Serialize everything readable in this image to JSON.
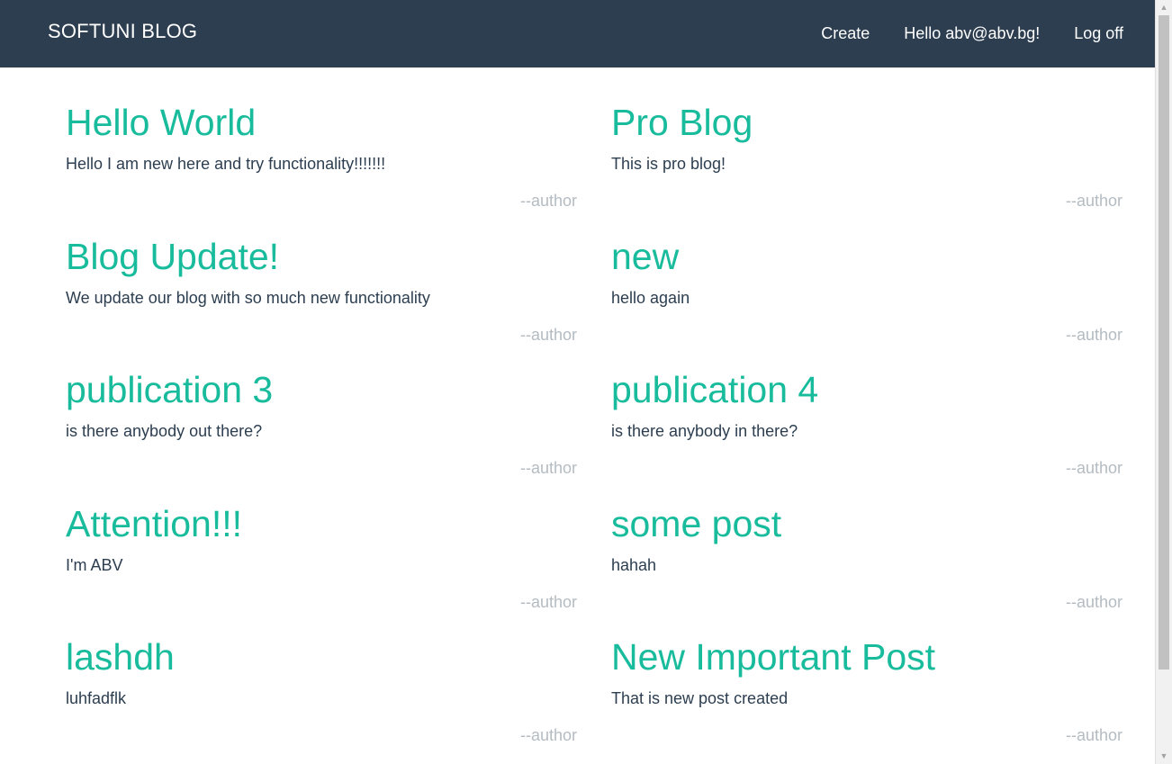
{
  "navbar": {
    "brand": "SOFTUNI BLOG",
    "links": [
      {
        "label": "Create"
      },
      {
        "label": "Hello abv@abv.bg!"
      },
      {
        "label": "Log off"
      }
    ]
  },
  "posts": [
    {
      "title": "Hello World",
      "content": "Hello I am new here and try functionality!!!!!!!",
      "author": "--author"
    },
    {
      "title": "Pro Blog",
      "content": "This is pro blog!",
      "author": "--author"
    },
    {
      "title": "Blog Update!",
      "content": "We update our blog with so much new functionality",
      "author": "--author"
    },
    {
      "title": "new",
      "content": "hello again",
      "author": "--author"
    },
    {
      "title": "publication 3",
      "content": "is there anybody out there?",
      "author": "--author"
    },
    {
      "title": "publication 4",
      "content": "is there anybody in there?",
      "author": "--author"
    },
    {
      "title": "Attention!!!",
      "content": "I'm ABV",
      "author": "--author"
    },
    {
      "title": "some post",
      "content": "hahah",
      "author": "--author"
    },
    {
      "title": "lashdh",
      "content": "luhfadflk",
      "author": "--author"
    },
    {
      "title": "New Important Post",
      "content": "That is new post created",
      "author": "--author"
    }
  ],
  "scrollbar": {
    "up_icon": "▲",
    "down_icon": "▼"
  }
}
